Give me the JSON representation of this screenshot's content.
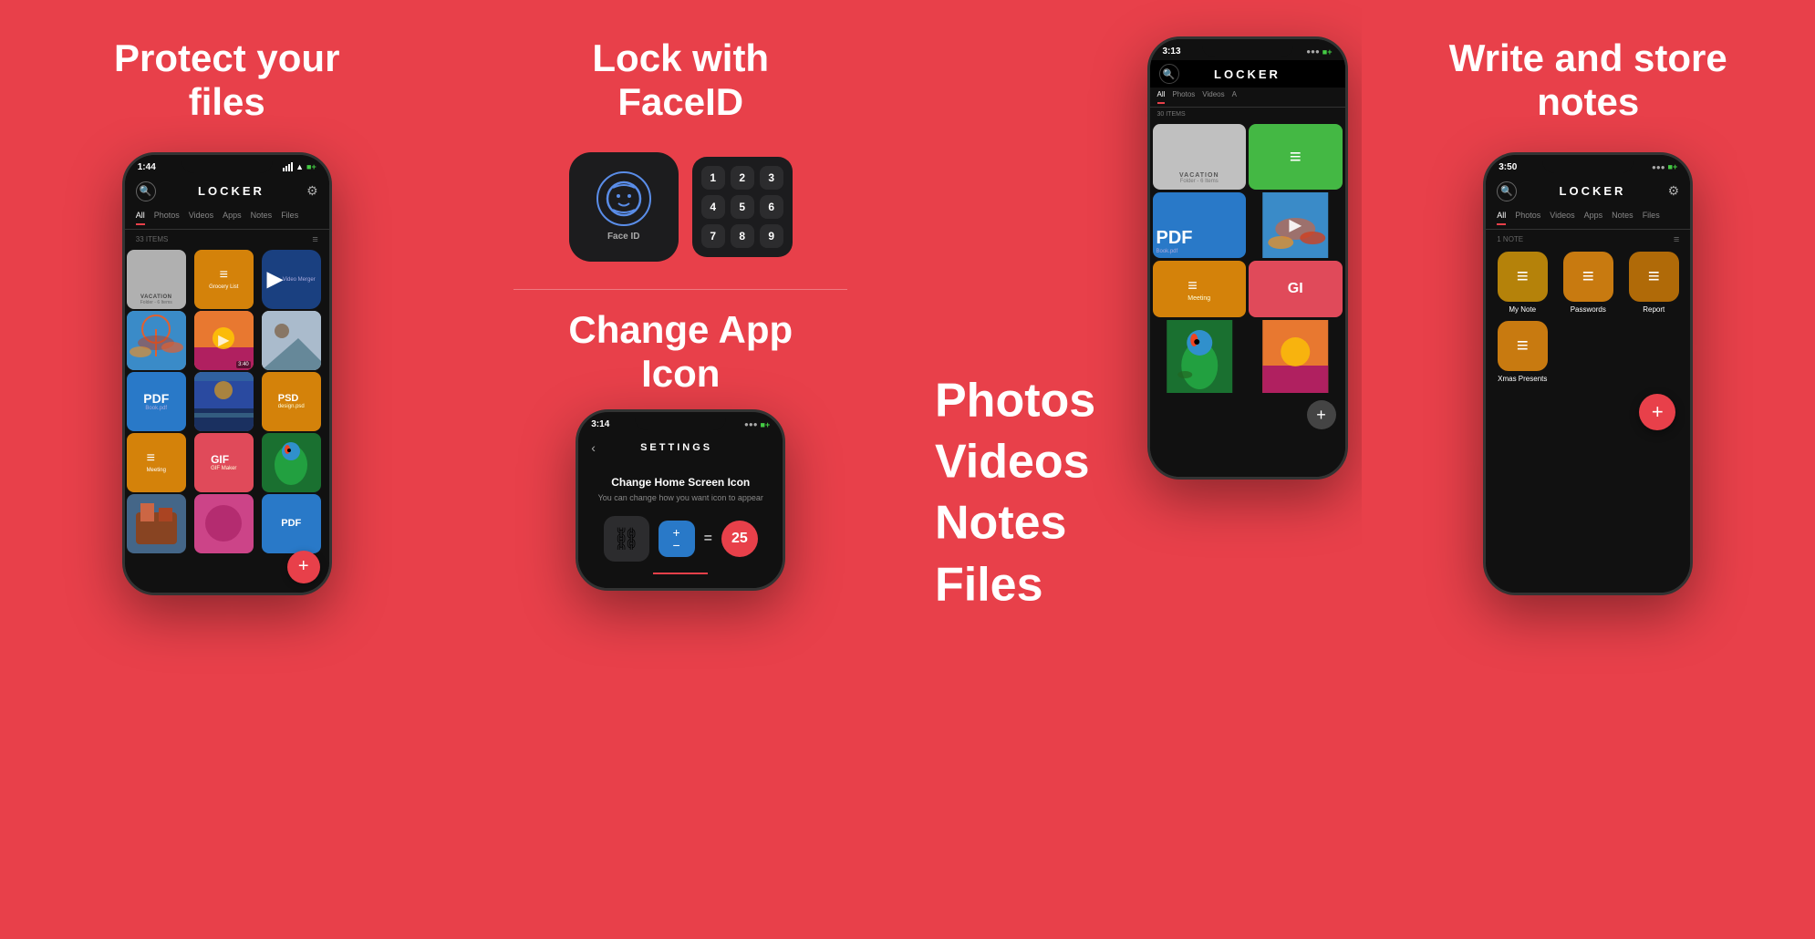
{
  "panels": [
    {
      "id": "panel1",
      "title": "Protect your\nfiles",
      "phone": {
        "time": "1:44",
        "app_name": "LOCKER",
        "tabs": [
          "All",
          "Photos",
          "Videos",
          "Apps",
          "Notes",
          "Files"
        ],
        "active_tab": "All",
        "items_count": "33 ITEMS",
        "files": [
          {
            "type": "folder",
            "label": "VACATION",
            "sub": "Folder - 6 Items"
          },
          {
            "type": "doc-orange",
            "label": "Grocery List"
          },
          {
            "type": "app-blue",
            "label": "Video Merger"
          },
          {
            "type": "photo-umbrella"
          },
          {
            "type": "video-sunset"
          },
          {
            "type": "photo-placeholder2"
          },
          {
            "type": "pdf",
            "label": "Book.pdf"
          },
          {
            "type": "video-beach"
          },
          {
            "type": "psd-orange",
            "label": "design.psd"
          },
          {
            "type": "doc-meeting",
            "label": "Meeting"
          },
          {
            "type": "gif",
            "label": "GIF Maker"
          },
          {
            "type": "photo-parrot"
          },
          {
            "type": "photo-art"
          },
          {
            "type": "photo-x"
          },
          {
            "type": "pdf-small"
          }
        ]
      }
    },
    {
      "id": "panel2",
      "title": "Lock with\nFaceID",
      "faceid_label": "Face ID",
      "numpad_keys": [
        "1",
        "2",
        "3",
        "4",
        "5",
        "6",
        "7",
        "8",
        "9"
      ],
      "change_icon_title": "Change App\nIcon",
      "settings_phone": {
        "time": "3:14",
        "section_title": "Change Home Screen Icon",
        "section_desc": "You can change how you want icon to appear",
        "number": "25"
      }
    },
    {
      "id": "panel3",
      "features": [
        "Photos",
        "Videos",
        "Notes",
        "Files"
      ],
      "phone": {
        "time": "3:13",
        "app_name": "LOCKER",
        "tabs": [
          "All",
          "Photos",
          "Videos",
          "A"
        ],
        "active_tab": "All",
        "items_count": "30 ITEMS"
      }
    },
    {
      "id": "panel4",
      "title": "Write and store\nnotes",
      "phone": {
        "time": "3:50",
        "app_name": "LOCKER",
        "tabs": [
          "All",
          "Photos",
          "Videos",
          "Apps",
          "Notes",
          "Files"
        ],
        "active_tab": "All",
        "items_count": "1 NOTE",
        "notes": [
          {
            "label": "My Note"
          },
          {
            "label": "Passwords"
          },
          {
            "label": "Report"
          },
          {
            "label": "Xmas Presents"
          }
        ]
      }
    }
  ]
}
